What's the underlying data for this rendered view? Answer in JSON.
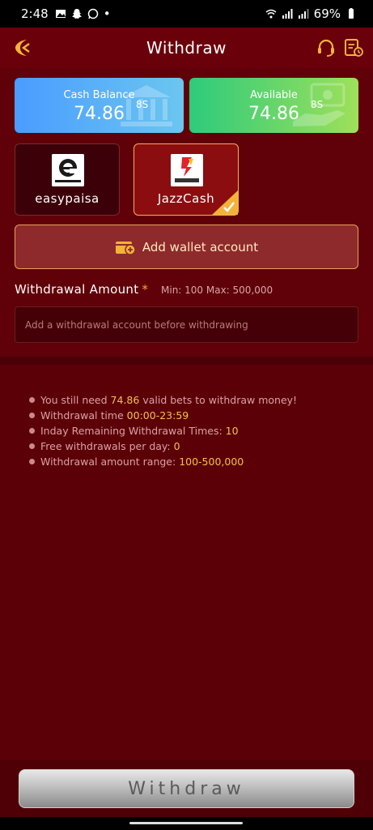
{
  "status_bar": {
    "time": "2:48",
    "dot": "•",
    "battery": "69%"
  },
  "header": {
    "title": "Withdraw"
  },
  "balances": {
    "cash": {
      "label": "Cash Balance",
      "value": "74.86",
      "currency": "8S"
    },
    "available": {
      "label": "Available",
      "value": "74.86",
      "currency": "8S"
    }
  },
  "payment_methods": [
    {
      "name": "easypaisa",
      "selected": false
    },
    {
      "name": "JazzCash",
      "selected": true
    }
  ],
  "add_wallet": {
    "label": "Add wallet account"
  },
  "amount": {
    "label": "Withdrawal Amount",
    "required_mark": "*",
    "range_hint": "Min: 100 Max: 500,000",
    "placeholder": "Add a withdrawal account before withdrawing"
  },
  "notes": [
    {
      "pre": "You still need ",
      "hl": "74.86",
      "post": " valid bets to withdraw money!"
    },
    {
      "pre": "Withdrawal time ",
      "hl": "00:00-23:59",
      "post": ""
    },
    {
      "pre": "Inday Remaining Withdrawal Times: ",
      "hl": "10",
      "post": ""
    },
    {
      "pre": "Free withdrawals per day: ",
      "hl": "0",
      "post": ""
    },
    {
      "pre": "Withdrawal amount range: ",
      "hl": "100-500,000",
      "post": ""
    }
  ],
  "withdraw_button": {
    "label": "Withdraw"
  },
  "colors": {
    "background": "#5e0008",
    "accent": "#f2c14a",
    "selected_border": "#f0b45a"
  },
  "icons": [
    "back-icon",
    "support-headset-icon",
    "record-icon",
    "bank-icon",
    "hand-money-icon",
    "wallet-add-icon",
    "check-icon"
  ]
}
